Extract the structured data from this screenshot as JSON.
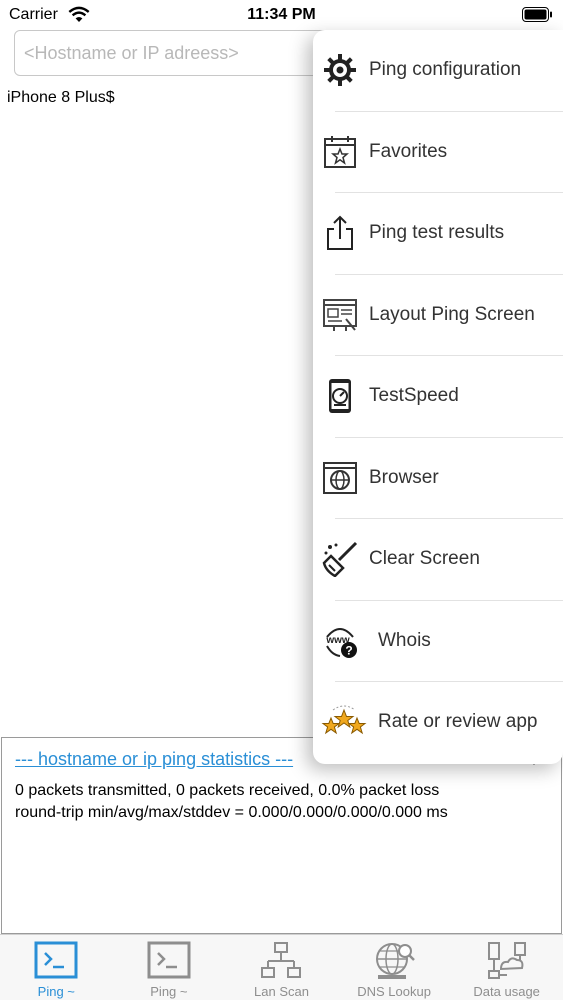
{
  "status_bar": {
    "carrier": "Carrier",
    "time": "11:34 PM"
  },
  "search": {
    "placeholder": "<Hostname or IP adreess>",
    "value": ""
  },
  "device_label": "iPhone 8 Plus$",
  "menu": {
    "items": [
      {
        "label": "Ping configuration",
        "icon": "gear-icon"
      },
      {
        "label": "Favorites",
        "icon": "calendar-star-icon"
      },
      {
        "label": "Ping test results",
        "icon": "share-icon"
      },
      {
        "label": "Layout Ping Screen",
        "icon": "layout-icon"
      },
      {
        "label": "TestSpeed",
        "icon": "speedometer-icon"
      },
      {
        "label": "Browser",
        "icon": "globe-icon"
      },
      {
        "label": "Clear Screen",
        "icon": "broom-icon"
      },
      {
        "label": "Whois",
        "icon": "www-question-icon"
      },
      {
        "label": "Rate or review app",
        "icon": "stars-icon"
      }
    ]
  },
  "stats": {
    "header": "--- hostname or ip ping statistics ---",
    "line1": "0 packets transmitted, 0 packets received, 0.0% packet loss",
    "line2": "round-trip min/avg/max/stddev = 0.000/0.000/0.000/0.000 ms"
  },
  "tabs": [
    {
      "label": "Ping ~",
      "icon": "terminal-icon",
      "active": true
    },
    {
      "label": "Ping ~",
      "icon": "terminal-icon",
      "active": false
    },
    {
      "label": "Lan Scan",
      "icon": "network-icon",
      "active": false
    },
    {
      "label": "DNS Lookup",
      "icon": "dns-globe-icon",
      "active": false
    },
    {
      "label": "Data usage",
      "icon": "data-usage-icon",
      "active": false
    }
  ],
  "colors": {
    "accent": "#2a8fd6",
    "inactive_tab": "#8e8e8e",
    "menu_text": "#333333"
  }
}
